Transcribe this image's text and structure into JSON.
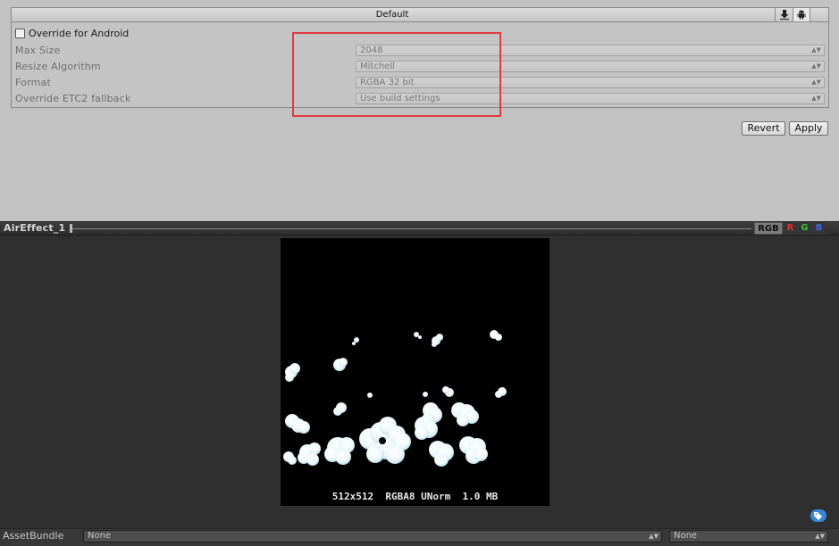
{
  "platform_tabs": {
    "title": "Default",
    "icons": [
      "download-icon",
      "android-icon"
    ]
  },
  "override": {
    "label": "Override for Android",
    "checked": false
  },
  "settings": [
    {
      "label": "Max Size",
      "value": "2048"
    },
    {
      "label": "Resize Algorithm",
      "value": "Mitchell"
    },
    {
      "label": "Format",
      "value": "RGBA 32 bit"
    },
    {
      "label": "Override ETC2 fallback",
      "value": "Use build settings"
    }
  ],
  "actions": {
    "revert_label": "Revert",
    "apply_label": "Apply"
  },
  "preview": {
    "title": "AirEffect_1",
    "channels": [
      "RGB",
      "R",
      "G",
      "B"
    ],
    "info": "512x512  RGBA8 UNorm  1.0 MB"
  },
  "asset_bundle": {
    "label": "AssetBundle",
    "name_value": "None",
    "variant_value": "None"
  },
  "colors": {
    "highlight": "#e0393e",
    "channel_r": "#e03030",
    "channel_g": "#36c236",
    "channel_b": "#3d6be6",
    "tag": "#3a86d6"
  }
}
